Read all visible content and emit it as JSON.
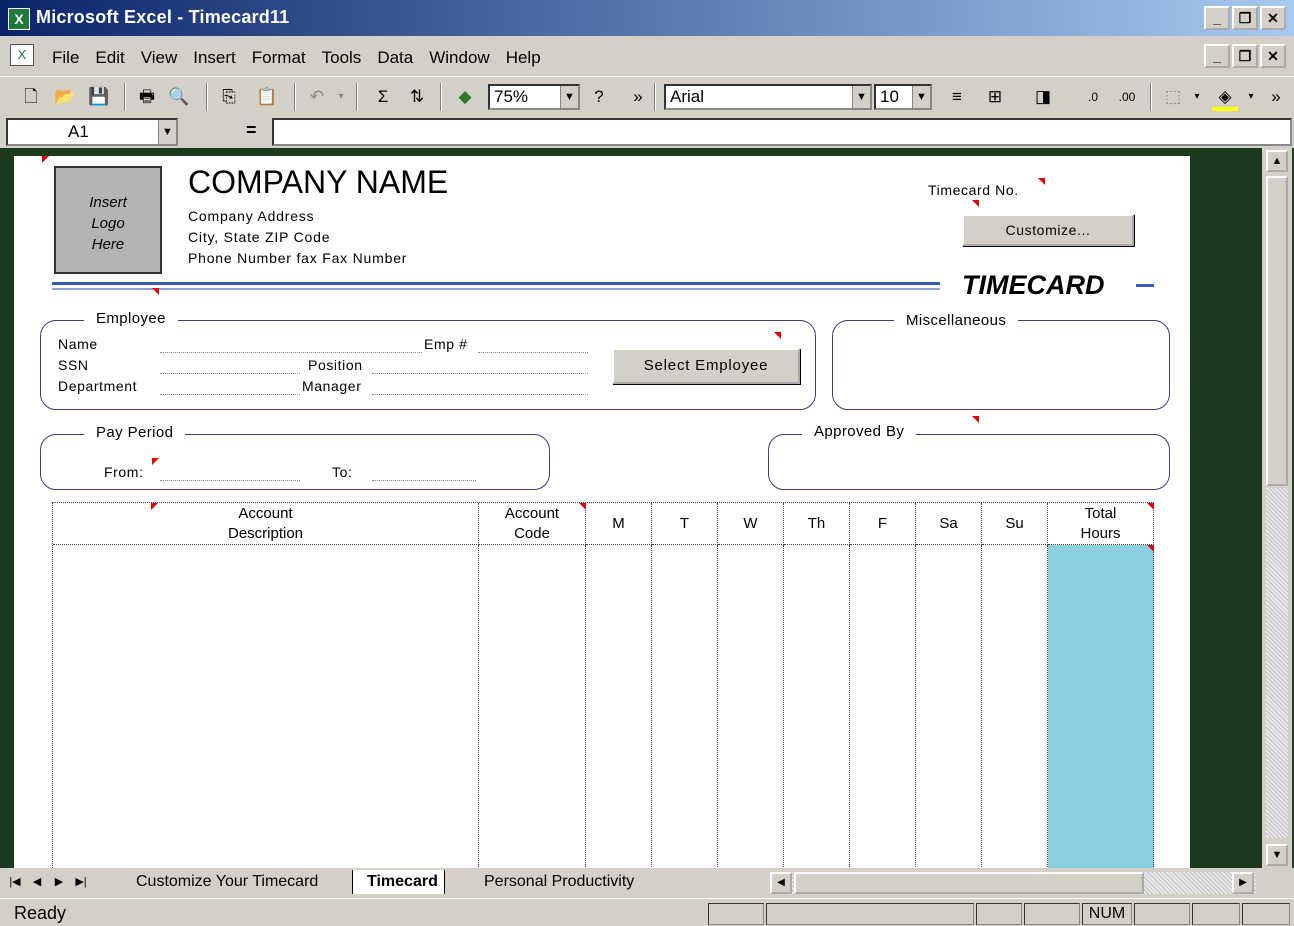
{
  "window": {
    "title": "Microsoft Excel - Timecard11",
    "app_icon": "excel-icon"
  },
  "menu": {
    "items": [
      "File",
      "Edit",
      "View",
      "Insert",
      "Format",
      "Tools",
      "Data",
      "Window",
      "Help"
    ]
  },
  "toolbar": {
    "zoom": "75%",
    "font": "Arial",
    "font_size": "10",
    "more": "»"
  },
  "formula_bar": {
    "cell_ref": "A1",
    "equals": "="
  },
  "sheet": {
    "logo_text": [
      "Insert",
      "Logo",
      "Here"
    ],
    "company_name": "COMPANY NAME",
    "company_address": "Company Address",
    "city_state": "City, State  ZIP Code",
    "phone": "Phone Number fax Fax Number",
    "timecard_no_label": "Timecard No.",
    "customize_button": "Customize...",
    "timecard_title": "TIMECARD",
    "employee": {
      "label": "Employee",
      "name": "Name",
      "emp_num": "Emp #",
      "ssn": "SSN",
      "position": "Position",
      "department": "Department",
      "manager": "Manager",
      "select_button": "Select Employee"
    },
    "misc_label": "Miscellaneous",
    "pay_period": {
      "label": "Pay Period",
      "from": "From:",
      "to": "To:"
    },
    "approved_by": "Approved By",
    "columns": [
      {
        "l1": "Account",
        "l2": "Description"
      },
      {
        "l1": "Account",
        "l2": "Code"
      },
      {
        "l1": "M",
        "l2": ""
      },
      {
        "l1": "T",
        "l2": ""
      },
      {
        "l1": "W",
        "l2": ""
      },
      {
        "l1": "Th",
        "l2": ""
      },
      {
        "l1": "F",
        "l2": ""
      },
      {
        "l1": "Sa",
        "l2": ""
      },
      {
        "l1": "Su",
        "l2": ""
      },
      {
        "l1": "Total",
        "l2": "Hours"
      }
    ]
  },
  "tabs": [
    "Customize Your Timecard",
    "Timecard",
    "Personal Productivity"
  ],
  "status": {
    "text": "Ready",
    "num": "NUM"
  }
}
